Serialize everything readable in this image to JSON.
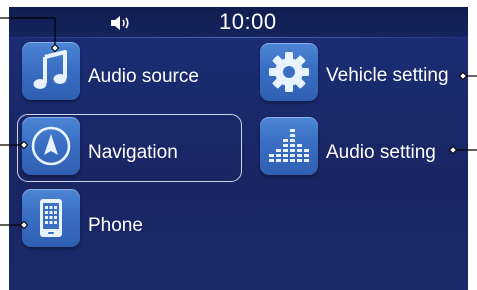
{
  "statusbar": {
    "time": "10:00",
    "volume_icon": "speaker-volume-icon"
  },
  "menu": [
    {
      "id": "audio-source",
      "label": "Audio source",
      "icon": "music-note-icon",
      "selected": false
    },
    {
      "id": "navigation",
      "label": "Navigation",
      "icon": "compass-arrow-icon",
      "selected": true
    },
    {
      "id": "phone",
      "label": "Phone",
      "icon": "phone-keypad-icon",
      "selected": false
    },
    {
      "id": "vehicle-setting",
      "label": "Vehicle setting",
      "icon": "gear-icon",
      "selected": false
    },
    {
      "id": "audio-setting",
      "label": "Audio setting",
      "icon": "equalizer-icon",
      "selected": false
    }
  ],
  "colors": {
    "screen_background": "#1a2563",
    "tile": "#3a6fc4",
    "text": "#ffffff",
    "callout": "#000000"
  }
}
